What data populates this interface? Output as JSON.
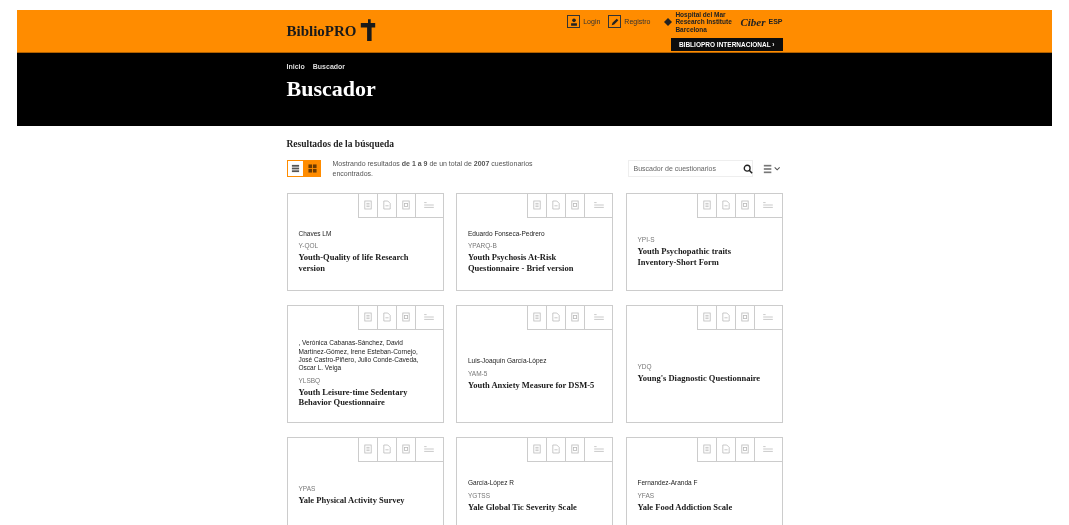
{
  "header": {
    "logo": "BiblioPRO",
    "links": [
      {
        "kind": "user",
        "label": "Login"
      },
      {
        "kind": "pencil",
        "label": "Registro"
      }
    ],
    "partner_text": "Hospital del Mar Research Institute Barcelona",
    "partner_logo": "Ciber",
    "partner_suffix": "ESP",
    "intl_button": "BIBLIOPRO INTERNACIONAL ›"
  },
  "breadcrumb": [
    "Inicio",
    "Buscador"
  ],
  "page_title": "Buscador",
  "results_heading": "Resultados de la búsqueda",
  "views": [
    {
      "kind": "list",
      "selected": false
    },
    {
      "kind": "grid",
      "selected": true
    }
  ],
  "summary": "Mostrando resultados **de 1 a 9** de un total de **2007** cuestionarios encontrados.",
  "search": {
    "placeholder": "Buscador de cuestionarios"
  },
  "cards": [
    {
      "author": "Chaves LM",
      "acronym": "Y-QOL",
      "title": "Youth-Quality of life Research version"
    },
    {
      "author": "Eduardo Fonseca-Pedrero",
      "acronym": "YPARQ-B",
      "title": "Youth Psychosis At-Risk Questionnaire - Brief version"
    },
    {
      "acronym": "YPI-S",
      "title": "Youth Psychopathic traits Inventory-Short Form"
    },
    {
      "author": ", Verónica Cabanas-Sánchez, David Martínez-Gómez, Irene Esteban-Cornejo, José Castro-Piñero, Julio Conde-Caveda, Oscar L. Veiga",
      "acronym": "YLSBQ",
      "title": "Youth Leisure-time Sedentary Behavior Questionnaire"
    },
    {
      "author": "Luis-Joaquín García-López",
      "acronym": "YAM-5",
      "title": "Youth Anxiety Measure for DSM-5"
    },
    {
      "acronym": "YDQ",
      "title": "Young's Diagnostic Questionnaire"
    },
    {
      "acronym": "YPAS",
      "title": "Yale Physical Activity Survey"
    },
    {
      "author": "García-López R",
      "acronym": "YGTSS",
      "title": "Yale Global Tic Severity Scale"
    },
    {
      "author": "Fernandez-Aranda F",
      "acronym": "YFAS",
      "title": "Yale Food Addiction Scale"
    }
  ]
}
